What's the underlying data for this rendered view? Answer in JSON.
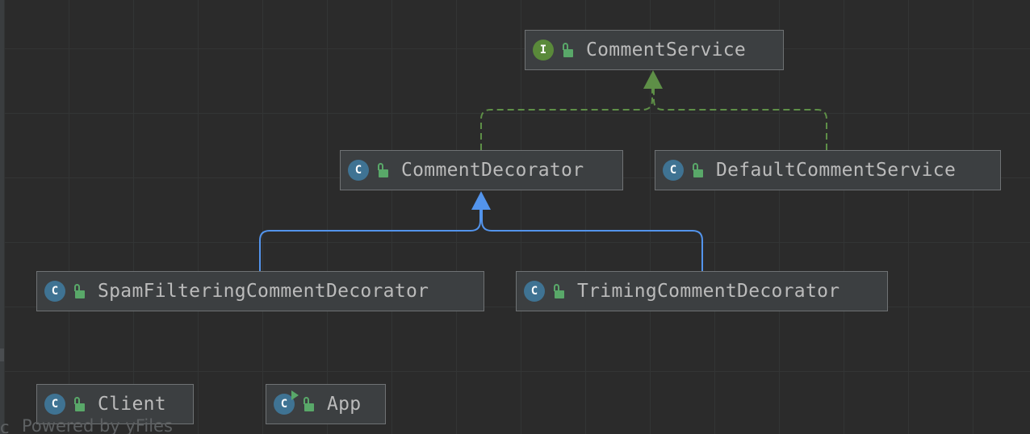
{
  "diagram": {
    "nodes": [
      {
        "id": "comment-service",
        "kind": "interface",
        "kind_letter": "I",
        "label": "CommentService"
      },
      {
        "id": "comment-decorator",
        "kind": "class",
        "kind_letter": "C",
        "label": "CommentDecorator"
      },
      {
        "id": "default-comment-service",
        "kind": "class",
        "kind_letter": "C",
        "label": "DefaultCommentService"
      },
      {
        "id": "spam-filtering-comment-decorator",
        "kind": "class",
        "kind_letter": "C",
        "label": "SpamFilteringCommentDecorator"
      },
      {
        "id": "triming-comment-decorator",
        "kind": "class",
        "kind_letter": "C",
        "label": "TrimingCommentDecorator"
      },
      {
        "id": "client",
        "kind": "class",
        "kind_letter": "C",
        "label": "Client"
      },
      {
        "id": "app",
        "kind": "class-runnable",
        "kind_letter": "C",
        "label": "App"
      }
    ],
    "edges": [
      {
        "from": "CommentDecorator",
        "to": "CommentService",
        "type": "implements"
      },
      {
        "from": "DefaultCommentService",
        "to": "CommentService",
        "type": "implements"
      },
      {
        "from": "SpamFilteringCommentDecorator",
        "to": "CommentDecorator",
        "type": "extends"
      },
      {
        "from": "TrimingCommentDecorator",
        "to": "CommentDecorator",
        "type": "extends"
      }
    ],
    "colors": {
      "background": "#2b2b2b",
      "grid": "#333535",
      "node_fill": "#3c3f41",
      "node_border": "#6f7274",
      "text": "#bbbbbb",
      "class_badge": "#3f7393",
      "interface_badge": "#5a8a3a",
      "public_lock": "#59a869",
      "implements_edge": "#5e8f47",
      "extends_edge": "#5394ec"
    }
  },
  "watermark": {
    "text": "Powered by yFiles",
    "side_char": "c"
  }
}
